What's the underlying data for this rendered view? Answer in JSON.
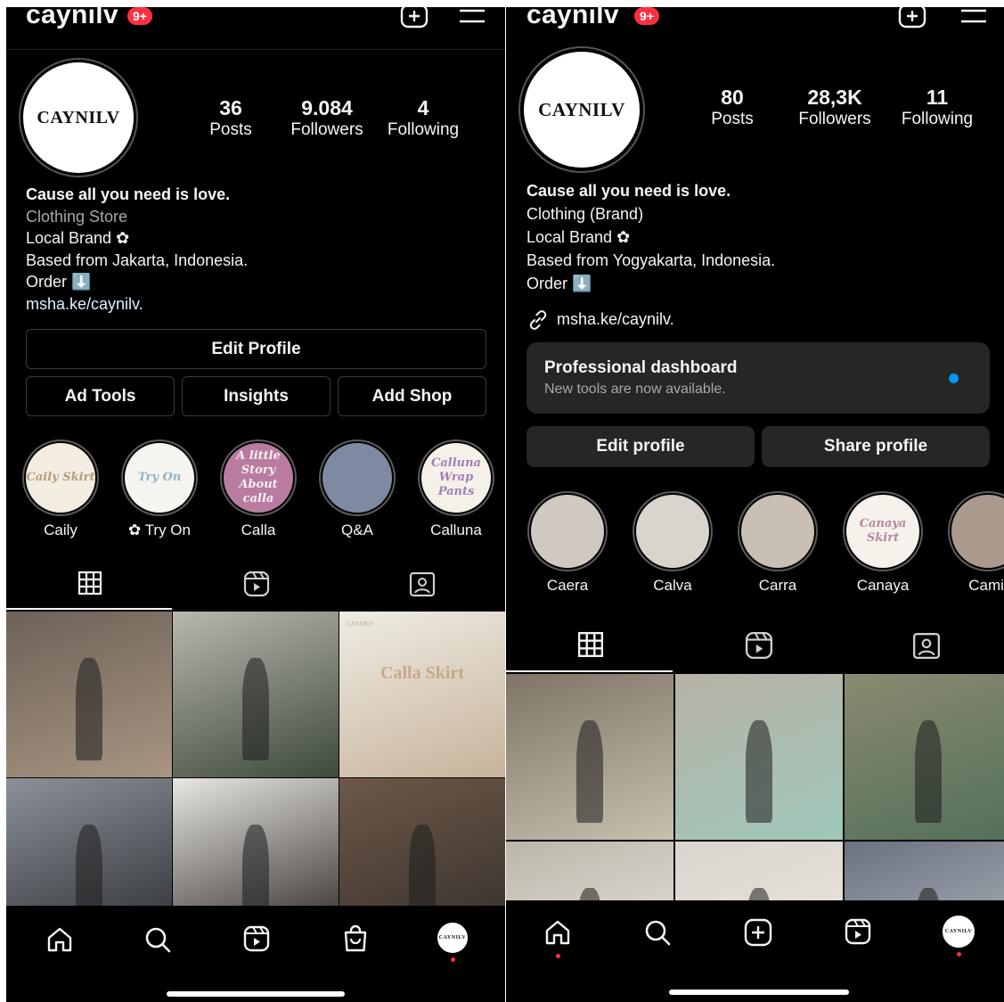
{
  "left": {
    "username": "caynilv",
    "notif_badge": "9+",
    "avatar_text": "CAYNILV",
    "stats": [
      {
        "value": "36",
        "label": "Posts"
      },
      {
        "value": "9.084",
        "label": "Followers"
      },
      {
        "value": "4",
        "label": "Following"
      }
    ],
    "bio": {
      "name": "Cause all you need is love.",
      "category": "Clothing Store",
      "line1": "Local Brand ✿",
      "line2": "Based from Jakarta, Indonesia.",
      "line3": "Order ⬇️",
      "link": "msha.ke/caynilv."
    },
    "buttons": {
      "edit": "Edit Profile",
      "ad_tools": "Ad Tools",
      "insights": "Insights",
      "add_shop": "Add Shop"
    },
    "highlights": [
      {
        "label": "Caily",
        "cover": "Caily Skirt",
        "bg": "#f3ece0",
        "fg": "#b99c78"
      },
      {
        "label": "✿ Try On",
        "cover": "Try On",
        "bg": "#f6f4ee",
        "fg": "#8fb3c3"
      },
      {
        "label": "Calla",
        "cover": "A little Story About calla",
        "bg": "#b97ca0",
        "fg": "#f7eef2"
      },
      {
        "label": "Q&A",
        "cover": "",
        "bg": "#7d8aa2",
        "fg": "#fff"
      },
      {
        "label": "Calluna",
        "cover": "Calluna Wrap Pants",
        "bg": "#f6f1e8",
        "fg": "#9f7fb8"
      }
    ],
    "grid": [
      {
        "bg": "#6c6258",
        "accent": "#a99582"
      },
      {
        "bg": "#b9b7ad",
        "accent": "#3d4a3c"
      },
      {
        "bg": "#efece4",
        "accent": "#c7b39a",
        "title": "Calla Skirt",
        "small": "CAYNILV"
      },
      {
        "bg": "#8c9199",
        "accent": "#2d2f33"
      },
      {
        "bg": "#e8e6e1",
        "accent": "#2a2624"
      },
      {
        "bg": "#6e5848",
        "accent": "#35302c"
      }
    ]
  },
  "right": {
    "username": "caynilv",
    "notif_badge": "9+",
    "avatar_text": "CAYNILV",
    "stats": [
      {
        "value": "80",
        "label": "Posts"
      },
      {
        "value": "28,3K",
        "label": "Followers"
      },
      {
        "value": "11",
        "label": "Following"
      }
    ],
    "bio": {
      "name": "Cause all you need is love.",
      "category": "Clothing (Brand)",
      "line1": "Local Brand ✿",
      "line2": "Based from Yogyakarta, Indonesia.",
      "line3": "Order ⬇️",
      "link": "msha.ke/caynilv."
    },
    "dashboard": {
      "title": "Professional dashboard",
      "subtitle": "New tools are now available."
    },
    "buttons": {
      "edit": "Edit profile",
      "share": "Share profile"
    },
    "highlights": [
      {
        "label": "Caera",
        "bg": "#cfc9c2",
        "fg": "#fff"
      },
      {
        "label": "Calva",
        "bg": "#d9d4cc",
        "fg": "#222"
      },
      {
        "label": "Carra",
        "bg": "#c9c0b3",
        "fg": "#d35"
      },
      {
        "label": "Canaya",
        "cover": "Canaya Skirt",
        "bg": "#f6f1ea",
        "fg": "#b48aa0"
      },
      {
        "label": "Camil",
        "bg": "#a99a8d",
        "fg": "#fff"
      }
    ],
    "grid": [
      {
        "bg": "#7e7567",
        "accent": "#c8bfae"
      },
      {
        "bg": "#b7b1a6",
        "accent": "#9fc8b9"
      },
      {
        "bg": "#8a8a70",
        "accent": "#53705a"
      },
      {
        "bg": "#bcb6aa",
        "accent": "#f1ede6"
      },
      {
        "bg": "#d9d5ce",
        "accent": "#eeeae4"
      },
      {
        "bg": "#6b7280",
        "accent": "#bfc4c9"
      }
    ]
  }
}
